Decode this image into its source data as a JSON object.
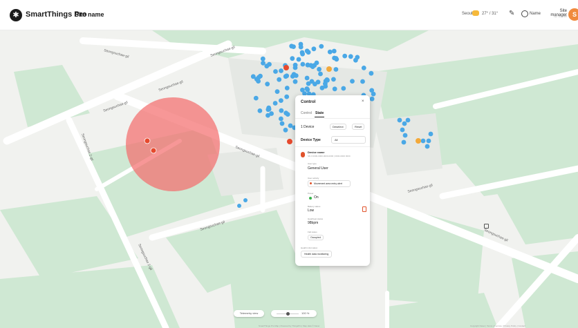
{
  "header": {
    "brand": "SmartThings Pro",
    "site_name": "Site name",
    "weather_label": "Seoul",
    "temperature": "27° / 31°",
    "user_label": "Name",
    "role_title": "Site manager",
    "role_sub": "ID name",
    "avatar_initial": "S"
  },
  "map": {
    "street_labels": [
      "Seongsuchae-gil",
      "Seongsuchae-gil",
      "Seongsuchae-gil",
      "Seongsuchae-gil",
      "Seongsuchae 2-gil",
      "Seongsuchae 2-gil",
      "Seongsuchae-gil",
      "Seongsuchae-gil",
      "Seongsuchae-gil",
      "Seongsuchae-gil"
    ]
  },
  "control_panel": {
    "title": "Control",
    "close": "×",
    "tabs": [
      "Control",
      "State"
    ],
    "active_tab": "State",
    "device_count": "1 Device",
    "select_all": "Deselect",
    "reset": "Reset",
    "device_type_label": "Device Type",
    "device_type_value": "All",
    "device_name": "Device name",
    "device_sub": "SN 0 0000-0000-0000-0000 | 0000-0000 0000",
    "user_type_label": "User type",
    "user_type_value": "General User",
    "user_activity_label": "User activity",
    "user_activity_value": "Movement area entry alert",
    "power_label": "Power",
    "power_value": "On",
    "battery_label": "Battery status",
    "battery_value": "Low",
    "heart_label": "Heartbeat status",
    "heart_value": "98bpm",
    "fall_label": "Fall status",
    "fall_value": "Occupied",
    "health_label": "Health information",
    "health_value": "Health data monitoring"
  },
  "bottom": {
    "telemetry": "Telemetry view",
    "zoom": "100 %",
    "copyright": "SmartThings Pro Map | Powered by ThingsPin | Map data © Naver",
    "links": "Copyright Naver | Terms of service | Privacy Policy | Contact"
  },
  "colors": {
    "map_bg": "#f1f2ef",
    "park": "#cfe8d3",
    "road": "#ffffff",
    "device_blue": "#4aa8e6",
    "device_orange": "#f3a93a",
    "device_red": "#e64a2e",
    "zone_red": "#f36b6b"
  }
}
